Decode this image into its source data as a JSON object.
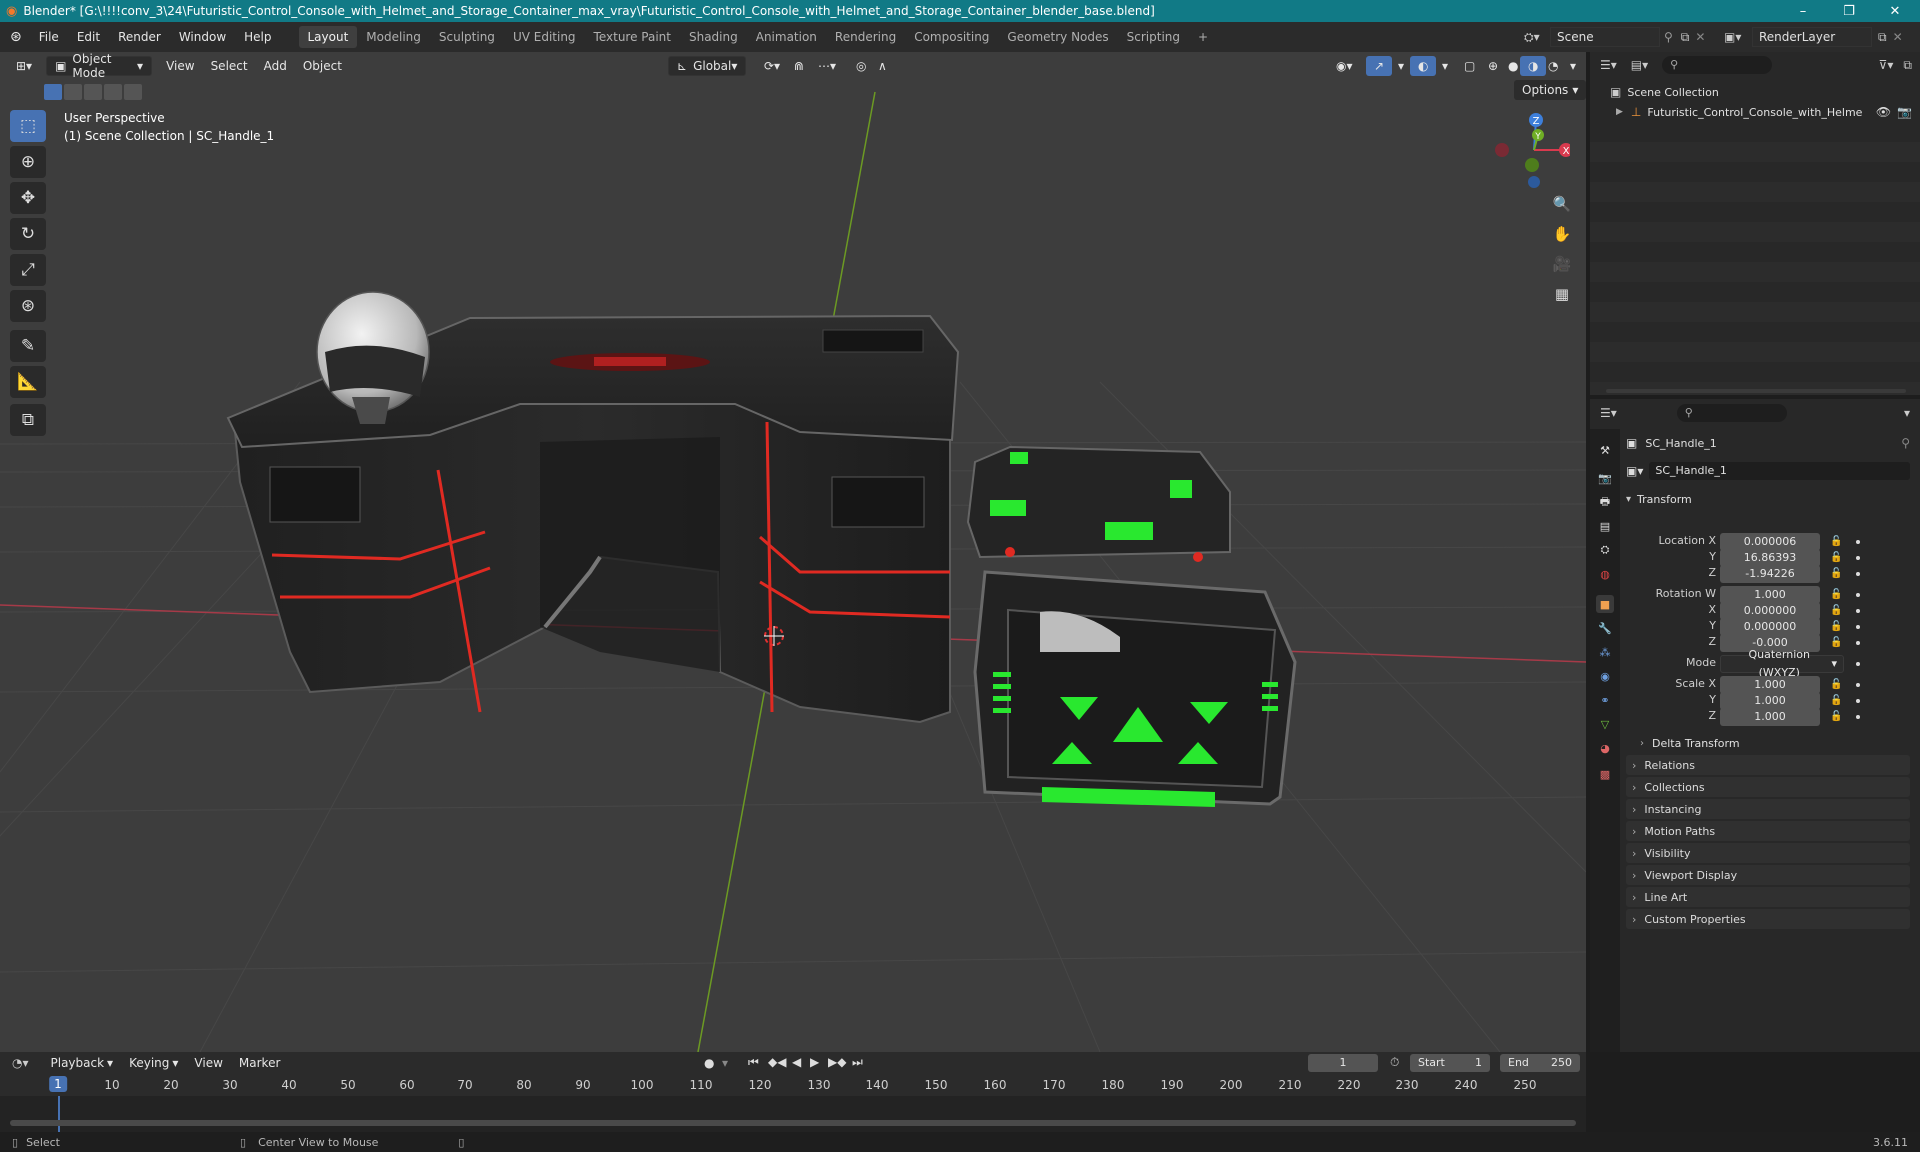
{
  "title_bar": {
    "title": "Blender* [G:\\!!!!conv_3\\24\\Futuristic_Control_Console_with_Helmet_and_Storage_Container_max_vray\\Futuristic_Control_Console_with_Helmet_and_Storage_Container_blender_base.blend]",
    "minimize": "–",
    "maximize": "❐",
    "close": "✕"
  },
  "menu": [
    "File",
    "Edit",
    "Render",
    "Window",
    "Help"
  ],
  "workspaces": [
    "Layout",
    "Modeling",
    "Sculpting",
    "UV Editing",
    "Texture Paint",
    "Shading",
    "Animation",
    "Rendering",
    "Compositing",
    "Geometry Nodes",
    "Scripting"
  ],
  "active_workspace": "Layout",
  "add_workspace": "+",
  "scene": {
    "label": "Scene"
  },
  "render_layer": {
    "label": "RenderLayer"
  },
  "viewport": {
    "mode": "Object Mode",
    "menus": [
      "View",
      "Select",
      "Add",
      "Object"
    ],
    "orientation": "Global",
    "options": "Options",
    "perspective": "User Perspective",
    "collection_info": "(1) Scene Collection | SC_Handle_1",
    "gizmo": {
      "z": "Z",
      "y": "Y",
      "x": "X"
    },
    "colors": {
      "axis_x": "#a63a48",
      "axis_y": "#6c9a23",
      "gizmo_x": "#d93a4e",
      "gizmo_y": "#6fae25",
      "gizmo_z": "#3d7fdb",
      "accent": "#4772b3"
    }
  },
  "outliner": {
    "root": "Scene Collection",
    "item": "Futuristic_Control_Console_with_Helme"
  },
  "properties": {
    "object_name": "SC_Handle_1",
    "data_name": "SC_Handle_1",
    "transform_label": "Transform",
    "location": {
      "label": "Location X",
      "x": "0.000006",
      "y": "16.86393",
      "z": "-1.94226"
    },
    "rotation": {
      "label": "Rotation W",
      "w": "1.000",
      "x": "0.000000",
      "y": "0.000000",
      "z": "-0.000"
    },
    "axis_labels": {
      "x": "X",
      "y": "Y",
      "z": "Z"
    },
    "mode": {
      "label": "Mode",
      "value": "Quaternion (WXYZ)"
    },
    "scale": {
      "label": "Scale X",
      "x": "1.000",
      "y": "1.000",
      "z": "1.000"
    },
    "delta_transform": "Delta Transform",
    "panels": [
      "Relations",
      "Collections",
      "Instancing",
      "Motion Paths",
      "Visibility",
      "Viewport Display",
      "Line Art",
      "Custom Properties"
    ]
  },
  "timeline": {
    "menus": [
      "Playback",
      "Keying",
      "View",
      "Marker"
    ],
    "current_frame": "1",
    "start_label": "Start",
    "start": "1",
    "end_label": "End",
    "end": "250",
    "ruler": [
      "1",
      "10",
      "20",
      "30",
      "40",
      "50",
      "60",
      "70",
      "80",
      "90",
      "100",
      "110",
      "120",
      "130",
      "140",
      "150",
      "160",
      "170",
      "180",
      "190",
      "200",
      "210",
      "220",
      "230",
      "240",
      "250"
    ]
  },
  "status": {
    "select": "Select",
    "center_view": "Center View to Mouse",
    "version": "3.6.11"
  }
}
